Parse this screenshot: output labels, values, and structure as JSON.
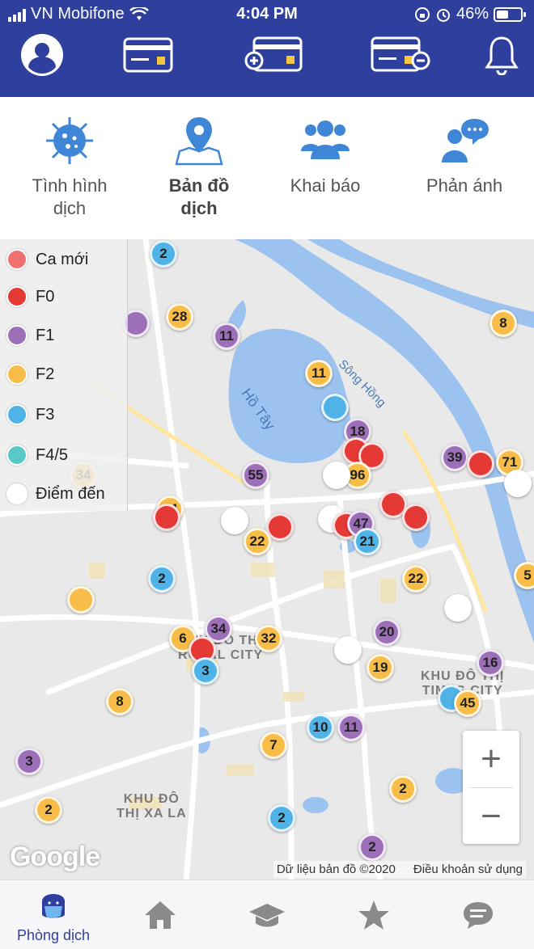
{
  "status_bar": {
    "carrier": "VN Mobifone",
    "time": "4:04 PM",
    "battery": "46%"
  },
  "header_icons": [
    "account-icon",
    "card-icon",
    "card-add-icon",
    "card-remove-icon",
    "bell-icon"
  ],
  "features": [
    {
      "label": "Tình hình\ndịch",
      "icon": "virus-icon"
    },
    {
      "label": "Bản đồ\ndịch",
      "icon": "map-pin-icon",
      "active": true
    },
    {
      "label": "Khai báo",
      "icon": "group-icon"
    },
    {
      "label": "Phản ánh",
      "icon": "feedback-icon"
    }
  ],
  "legend": [
    {
      "label": "Ca mới",
      "color": "#f07070"
    },
    {
      "label": "F0",
      "color": "#e53935"
    },
    {
      "label": "F1",
      "color": "#9c6fb8"
    },
    {
      "label": "F2",
      "color": "#f7bd48"
    },
    {
      "label": "F3",
      "color": "#4fb3e8"
    },
    {
      "label": "F4/5",
      "color": "#5bc8c8"
    },
    {
      "label": "Điểm đến",
      "color": "#ffffff"
    }
  ],
  "map_labels": {
    "lake": "Hồ Tây",
    "river": "Sông Hồng",
    "royal": "KHU ĐÔ THỊ\nROYAL CITY",
    "times": "KHU ĐÔ THỊ\nTIMES CITY",
    "xala": "KHU ĐÔ\nTHỊ XA LA"
  },
  "markers": [
    {
      "v": "2",
      "c": "F3"
    },
    {
      "v": "28",
      "c": "F2"
    },
    {
      "v": "",
      "c": "F1"
    },
    {
      "v": "11",
      "c": "F1"
    },
    {
      "v": "8",
      "c": "F2"
    },
    {
      "v": "11",
      "c": "F2"
    },
    {
      "v": "",
      "c": "F3"
    },
    {
      "v": "18",
      "c": "F1"
    },
    {
      "v": "",
      "c": "F0"
    },
    {
      "v": "",
      "c": "F0"
    },
    {
      "v": "96",
      "c": "F2"
    },
    {
      "v": "",
      "c": "Điểm đến"
    },
    {
      "v": "39",
      "c": "F1"
    },
    {
      "v": "",
      "c": "F0"
    },
    {
      "v": "71",
      "c": "F2"
    },
    {
      "v": "",
      "c": "Điểm đến"
    },
    {
      "v": "34",
      "c": "F2"
    },
    {
      "v": "55",
      "c": "F1"
    },
    {
      "v": "44",
      "c": "F2"
    },
    {
      "v": "",
      "c": "F0"
    },
    {
      "v": "",
      "c": "Điểm đến"
    },
    {
      "v": "",
      "c": "F0"
    },
    {
      "v": "22",
      "c": "F2"
    },
    {
      "v": "",
      "c": "Điểm đến"
    },
    {
      "v": "",
      "c": "F0"
    },
    {
      "v": "47",
      "c": "F1"
    },
    {
      "v": "",
      "c": "F0"
    },
    {
      "v": "",
      "c": "F0"
    },
    {
      "v": "21",
      "c": "F3"
    },
    {
      "v": "2",
      "c": "F3"
    },
    {
      "v": "",
      "c": "F2"
    },
    {
      "v": "22",
      "c": "F2"
    },
    {
      "v": "",
      "c": "Điểm đến"
    },
    {
      "v": "5",
      "c": "F2"
    },
    {
      "v": "6",
      "c": "F2"
    },
    {
      "v": "34",
      "c": "F1"
    },
    {
      "v": "32",
      "c": "F2"
    },
    {
      "v": "",
      "c": "F0"
    },
    {
      "v": "3",
      "c": "F3"
    },
    {
      "v": "20",
      "c": "F1"
    },
    {
      "v": "",
      "c": "Điểm đến"
    },
    {
      "v": "19",
      "c": "F2"
    },
    {
      "v": "16",
      "c": "F1"
    },
    {
      "v": "",
      "c": "F3"
    },
    {
      "v": "45",
      "c": "F2"
    },
    {
      "v": "8",
      "c": "F2"
    },
    {
      "v": "10",
      "c": "F3"
    },
    {
      "v": "11",
      "c": "F1"
    },
    {
      "v": "7",
      "c": "F2"
    },
    {
      "v": "3",
      "c": "F1"
    },
    {
      "v": "2",
      "c": "F2"
    },
    {
      "v": "2",
      "c": "F2"
    },
    {
      "v": "2",
      "c": "F3"
    },
    {
      "v": "2",
      "c": "F1"
    }
  ],
  "zoom": {
    "in": "+",
    "out": "−"
  },
  "google_logo": "Google",
  "attribution": {
    "data": "Dữ liệu bản đồ ©2020",
    "terms": "Điều khoản sử dụng"
  },
  "tabs": [
    {
      "label": "Phòng dịch",
      "icon": "mask-person-icon",
      "active": true
    },
    {
      "label": "",
      "icon": "home-icon"
    },
    {
      "label": "",
      "icon": "graduation-cap-icon"
    },
    {
      "label": "",
      "icon": "star-icon"
    },
    {
      "label": "",
      "icon": "chat-icon"
    }
  ]
}
